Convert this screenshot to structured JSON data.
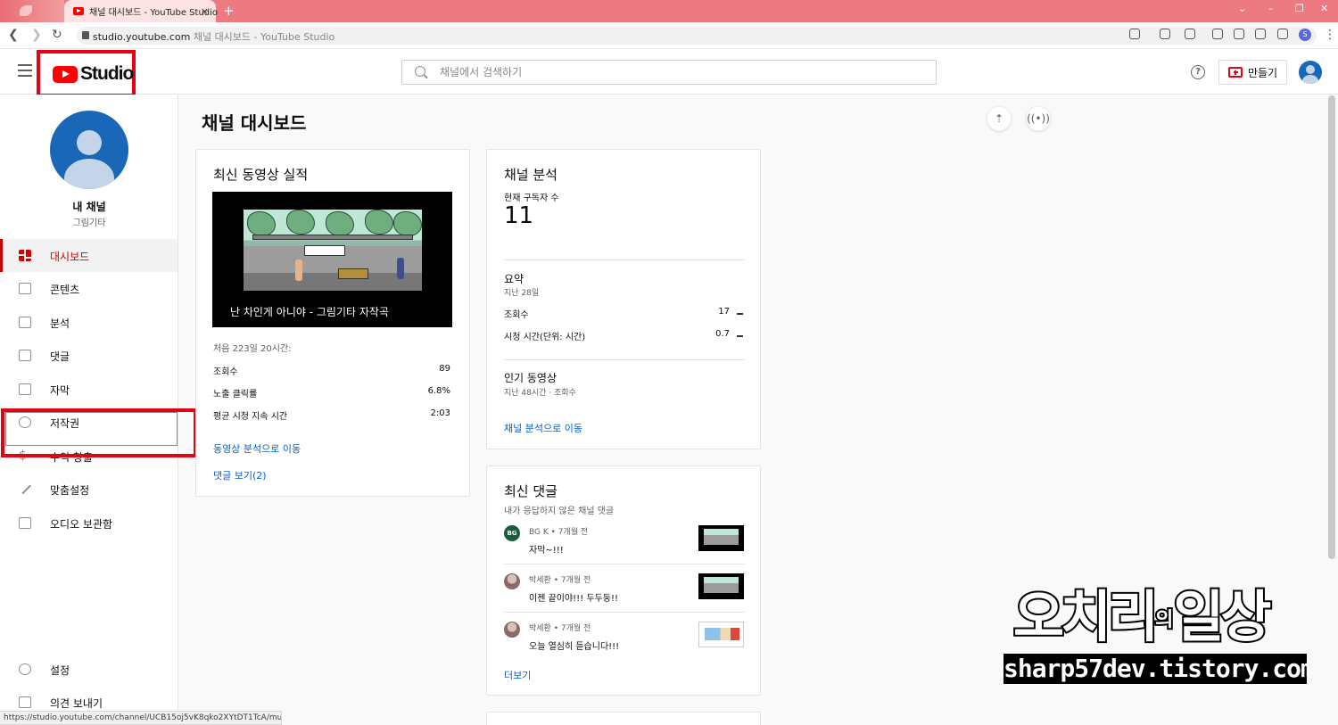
{
  "browser": {
    "tab_title": "채널 대시보드 - YouTube Studio",
    "tab_close": "×",
    "new_tab": "+",
    "url_host": "studio.youtube.com",
    "url_title": "채널 대시보드 - YouTube Studio",
    "profile_initial": "S",
    "status_url": "https://studio.youtube.com/channel/UCB15oj5vK8qko2XYtDT1TcA/music"
  },
  "header": {
    "logo_text": "Studio",
    "search_placeholder": "채널에서 검색하기",
    "help_label": "?",
    "create_label": "만들기"
  },
  "sidebar": {
    "channel_name": "내 채널",
    "channel_sub": "그림기타",
    "items": [
      {
        "label": "대시보드",
        "icon": "dashboard-icon"
      },
      {
        "label": "콘텐츠",
        "icon": "content-icon"
      },
      {
        "label": "분석",
        "icon": "analytics-icon"
      },
      {
        "label": "댓글",
        "icon": "comments-icon"
      },
      {
        "label": "자막",
        "icon": "subtitles-icon"
      },
      {
        "label": "저작권",
        "icon": "copyright-icon"
      },
      {
        "label": "수익 창출",
        "icon": "dollar-icon"
      },
      {
        "label": "맞춤설정",
        "icon": "wand-icon"
      },
      {
        "label": "오디오 보관함",
        "icon": "audio-library-icon"
      }
    ],
    "settings_label": "설정",
    "feedback_label": "의견 보내기"
  },
  "main": {
    "page_title": "채널 대시보드",
    "latest_video": {
      "title": "최신 동영상 실적",
      "video_title": "난 차인게 아니야 - 그림기타 자작곡",
      "period": "처음 223일 20시간:",
      "stats": [
        {
          "label": "조회수",
          "value": "89"
        },
        {
          "label": "노출 클릭률",
          "value": "6.8%"
        },
        {
          "label": "평균 시청 지속 시간",
          "value": "2:03"
        }
      ],
      "analytics_link": "동영상 분석으로 이동",
      "comments_link": "댓글 보기(2)"
    },
    "channel_analytics": {
      "title": "채널 분석",
      "subscribers_label": "현재 구독자 수",
      "subscribers_value": "11",
      "summary_title": "요약",
      "summary_period": "지난 28일",
      "summary_rows": [
        {
          "label": "조회수",
          "value": "17"
        },
        {
          "label": "시청 시간(단위: 시간)",
          "value": "0.7"
        }
      ],
      "popular_title": "인기 동영상",
      "popular_sub": "지난 48시간 · 조회수",
      "link": "채널 분석으로 이동"
    },
    "recent_comments": {
      "title": "최신 댓글",
      "subtitle": "내가 응답하지 않은 채널 댓글",
      "comments": [
        {
          "avatar_text": "BG",
          "meta": "BG K • 7개월 전",
          "text": "자막~!!!"
        },
        {
          "meta": "박세환 • 7개월 전",
          "text": "이젠 끝이야!!! 두두둥!!"
        },
        {
          "meta": "박세환 • 7개월 전",
          "text": "오늘 열심히 듣습니다!!!"
        }
      ],
      "more_link": "더보기"
    }
  },
  "watermark": {
    "line1_a": "오치리",
    "line1_small": "의",
    "line1_b": "일상",
    "line2": "sharp57dev.tistory.com"
  },
  "colors": {
    "tabbar": "#ec7a80",
    "brand_red": "#ff0000",
    "highlight_box": "#e60012",
    "active_nav": "#cc0000",
    "link": "#065fd4"
  }
}
